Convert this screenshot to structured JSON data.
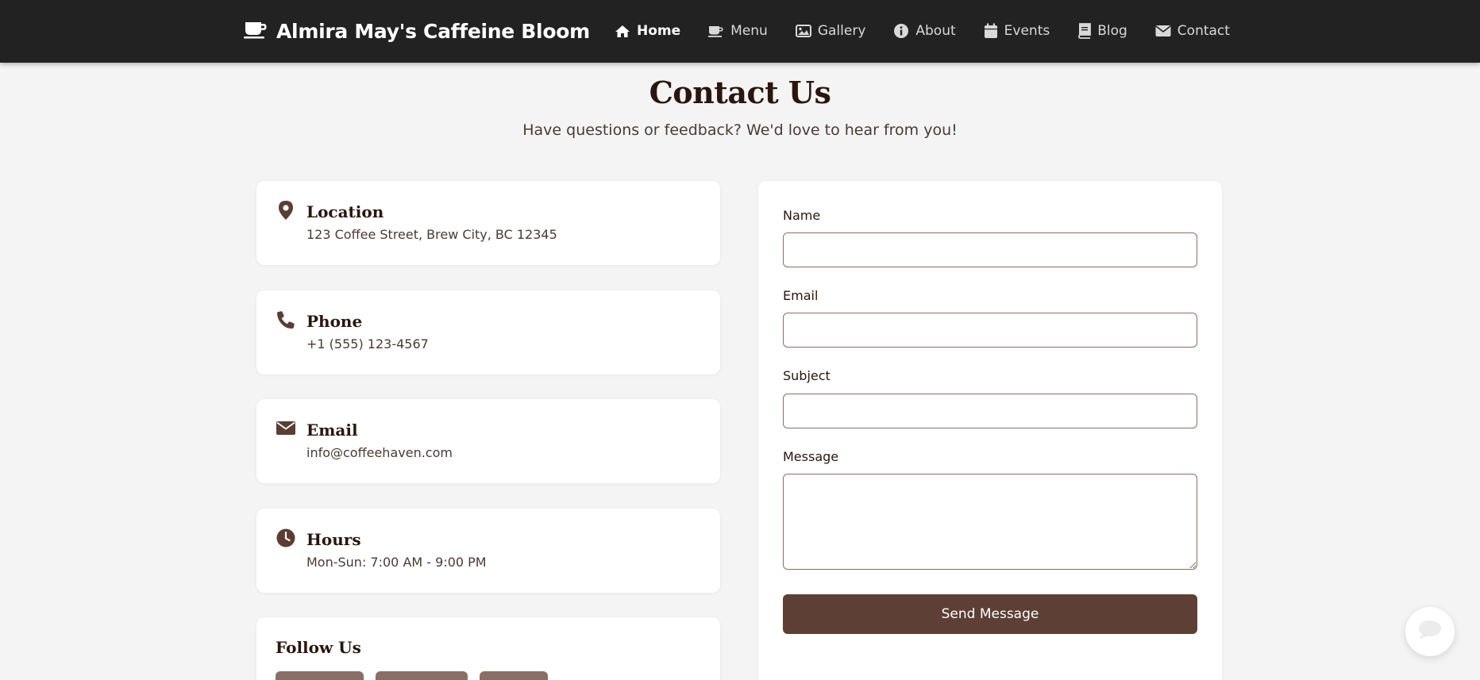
{
  "brand": {
    "name": "Almira May's Caffeine Bloom",
    "icon": "coffee-cup-icon"
  },
  "nav": {
    "items": [
      {
        "label": "Home",
        "icon": "home-icon",
        "active": true
      },
      {
        "label": "Menu",
        "icon": "coffee-cup-icon"
      },
      {
        "label": "Gallery",
        "icon": "image-icon"
      },
      {
        "label": "About",
        "icon": "info-circle-icon"
      },
      {
        "label": "Events",
        "icon": "calendar-icon"
      },
      {
        "label": "Blog",
        "icon": "book-icon"
      },
      {
        "label": "Contact",
        "icon": "envelope-icon"
      }
    ]
  },
  "header": {
    "title": "Contact Us",
    "subtitle": "Have questions or feedback? We'd love to hear from you!"
  },
  "info_cards": [
    {
      "title": "Location",
      "text": "123 Coffee Street, Brew City, BC 12345",
      "icon": "map-marker-icon"
    },
    {
      "title": "Phone",
      "text": "+1 (555) 123-4567",
      "icon": "phone-icon"
    },
    {
      "title": "Email",
      "text": "info@coffeehaven.com",
      "icon": "envelope-icon"
    },
    {
      "title": "Hours",
      "text": "Mon-Sun: 7:00 AM - 9:00 PM",
      "icon": "clock-icon"
    }
  ],
  "follow": {
    "title": "Follow Us"
  },
  "form": {
    "name_label": "Name",
    "name_value": "",
    "email_label": "Email",
    "email_value": "",
    "subject_label": "Subject",
    "subject_value": "",
    "message_label": "Message",
    "message_value": "",
    "submit_label": "Send Message"
  },
  "chat": {
    "icon": "chat-bubble-icon"
  },
  "colors": {
    "nav_bg": "#222222",
    "page_bg": "#f4f4f4",
    "accent": "#5d3f36",
    "heading": "#2a160d",
    "social_button": "#8a6e65"
  }
}
